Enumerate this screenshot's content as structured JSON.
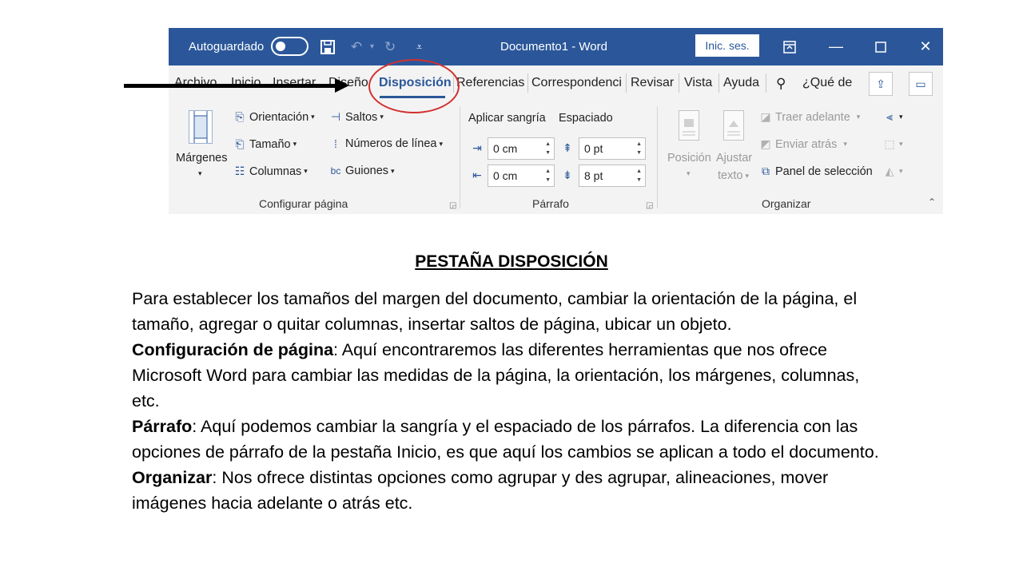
{
  "titlebar": {
    "autosave_label": "Autoguardado",
    "doc_title": "Documento1  -  Word",
    "signin_label": "Inic. ses.",
    "qat_icons": [
      "save-icon",
      "undo-icon",
      "redo-icon",
      "customize-icon"
    ],
    "window_icons": [
      "ribbon-display-icon",
      "minimize-icon",
      "maximize-icon",
      "close-icon"
    ],
    "bg_color": "#2b579a"
  },
  "tabs": {
    "items": [
      "Archivo",
      "Inicio",
      "Insertar",
      "Diseño",
      "Disposición",
      "Referencias",
      "Correspondenci",
      "Revisar",
      "Vista",
      "Ayuda"
    ],
    "active": "Disposición",
    "search_text": "¿Qué de"
  },
  "ribbon": {
    "page_setup": {
      "margins_label": "Márgenes",
      "orientation": "Orientación",
      "size": "Tamaño",
      "columns": "Columnas",
      "breaks": "Saltos",
      "line_numbers": "Números de línea",
      "hyphenation": "Guiones",
      "group_label": "Configurar página"
    },
    "paragraph": {
      "indent_label": "Aplicar sangría",
      "spacing_label": "Espaciado",
      "indent_left": "0 cm",
      "indent_right": "0 cm",
      "spacing_before": "0 pt",
      "spacing_after": "8 pt",
      "group_label": "Párrafo"
    },
    "arrange": {
      "position": "Posición",
      "wrap_text_1": "Ajustar",
      "wrap_text_2": "texto",
      "bring_forward": "Traer adelante",
      "send_backward": "Enviar atrás",
      "selection_pane": "Panel de selección",
      "group_label": "Organizar"
    }
  },
  "content": {
    "heading": "PESTAÑA DISPOSICIÓN",
    "intro": "Para establecer los tamaños del margen del documento, cambiar la orientación de la página, el tamaño, agregar o quitar columnas, insertar saltos de página, ubicar un objeto.",
    "p1_term": "Configuración de página",
    "p1_text": ": Aquí encontraremos las diferentes herramientas que nos ofrece Microsoft Word para cambiar las medidas de la página, la orientación, los márgenes, columnas, etc.",
    "p2_term": "Párrafo",
    "p2_text": ": Aquí podemos cambiar la sangría y el espaciado de los párrafos. La diferencia con las opciones de párrafo de la pestaña Inicio, es que aquí los cambios se aplican a todo el documento.",
    "p3_term": "Organizar",
    "p3_text": ": Nos ofrece distintas opciones como agrupar y des agrupar, alineaciones, mover imágenes hacia adelante o atrás etc."
  }
}
